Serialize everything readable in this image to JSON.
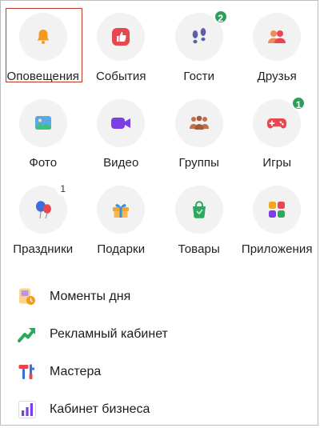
{
  "grid": {
    "tiles": [
      {
        "label": "Оповещения",
        "icon": "bell-icon",
        "badge": "",
        "selected": true
      },
      {
        "label": "События",
        "icon": "thumbs-up-icon",
        "badge": ""
      },
      {
        "label": "Гости",
        "icon": "footprints-icon",
        "badge": "2"
      },
      {
        "label": "Друзья",
        "icon": "friends-icon",
        "badge": ""
      },
      {
        "label": "Фото",
        "icon": "photo-icon",
        "badge": ""
      },
      {
        "label": "Видео",
        "icon": "video-camera-icon",
        "badge": ""
      },
      {
        "label": "Группы",
        "icon": "group-icon",
        "badge": ""
      },
      {
        "label": "Игры",
        "icon": "gamepad-icon",
        "badge": "1"
      },
      {
        "label": "Праздники",
        "icon": "balloons-icon",
        "badge": "1"
      },
      {
        "label": "Подарки",
        "icon": "gift-icon",
        "badge": ""
      },
      {
        "label": "Товары",
        "icon": "shopping-bag-icon",
        "badge": ""
      },
      {
        "label": "Приложения",
        "icon": "apps-icon",
        "badge": ""
      }
    ]
  },
  "list": {
    "items": [
      {
        "label": "Моменты дня",
        "icon": "moments-icon"
      },
      {
        "label": "Рекламный кабинет",
        "icon": "trend-arrow-icon"
      },
      {
        "label": "Мастера",
        "icon": "tools-icon"
      },
      {
        "label": "Кабинет бизнеса",
        "icon": "bar-chart-icon"
      }
    ]
  },
  "colors": {
    "badge_green": "#2e9e5b",
    "selection_red": "#c0392b",
    "tile_bg": "#f2f2f2"
  }
}
